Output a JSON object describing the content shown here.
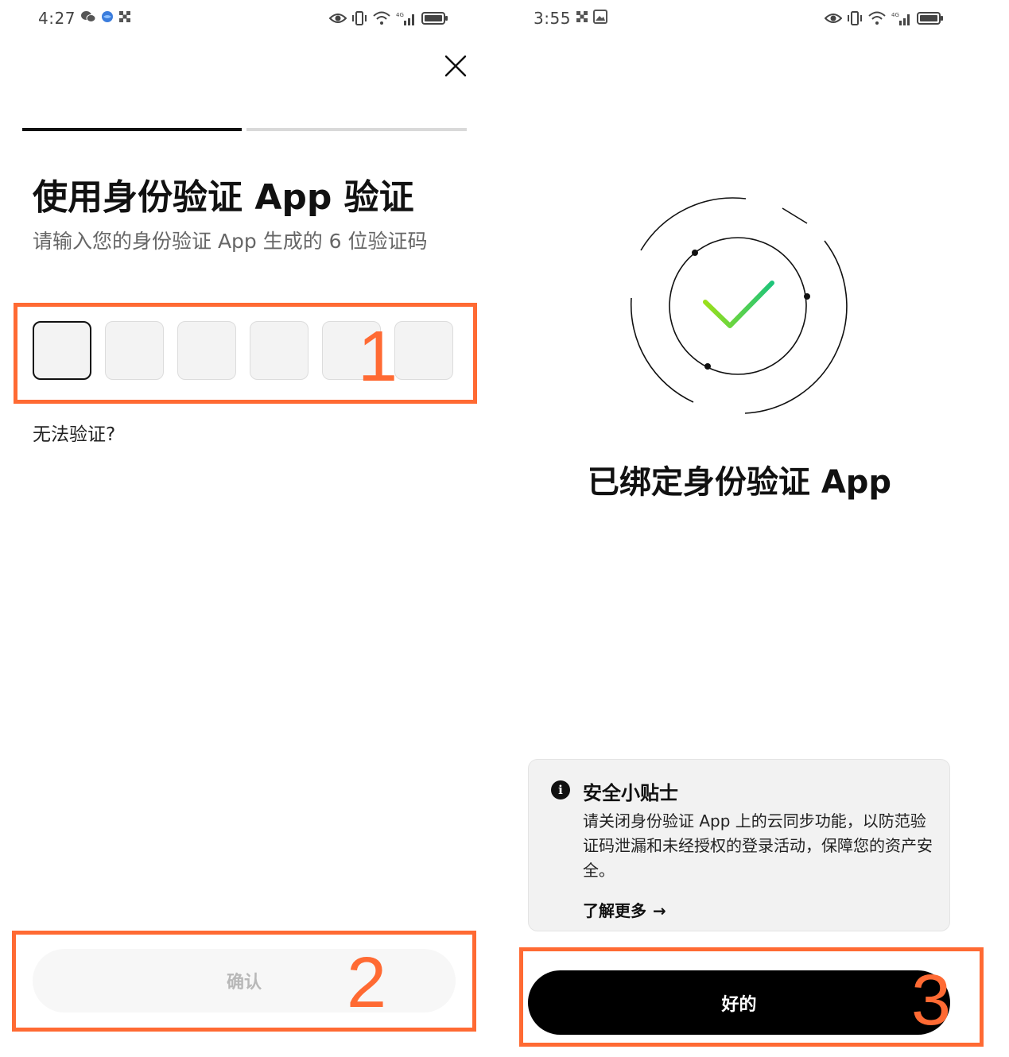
{
  "left_screen": {
    "status_bar": {
      "time": "4:27"
    },
    "close_label": "×",
    "title": "使用身份验证 App 验证",
    "subtitle": "请输入您的身份验证 App 生成的 6 位验证码",
    "code_boxes": [
      "",
      "",
      "",
      "",
      "",
      ""
    ],
    "cant_verify": "无法验证?",
    "confirm_label": "确认"
  },
  "right_screen": {
    "status_bar": {
      "time": "3:55"
    },
    "bound_title": "已绑定身份验证 App",
    "tip": {
      "icon_label": "i",
      "title": "安全小贴士",
      "body": "请关闭身份验证 App 上的云同步功能，以防范验证码泄漏和未经授权的登录活动，保障您的资产安全。",
      "learn_more": "了解更多",
      "learn_more_arrow": "→"
    },
    "ok_label": "好的"
  },
  "annotations": [
    "1",
    "2",
    "3"
  ],
  "colors": {
    "annotation": "#ff6a33",
    "primary": "#000000",
    "check_gradient_start": "#7bd61f",
    "check_gradient_end": "#1ec47a"
  }
}
